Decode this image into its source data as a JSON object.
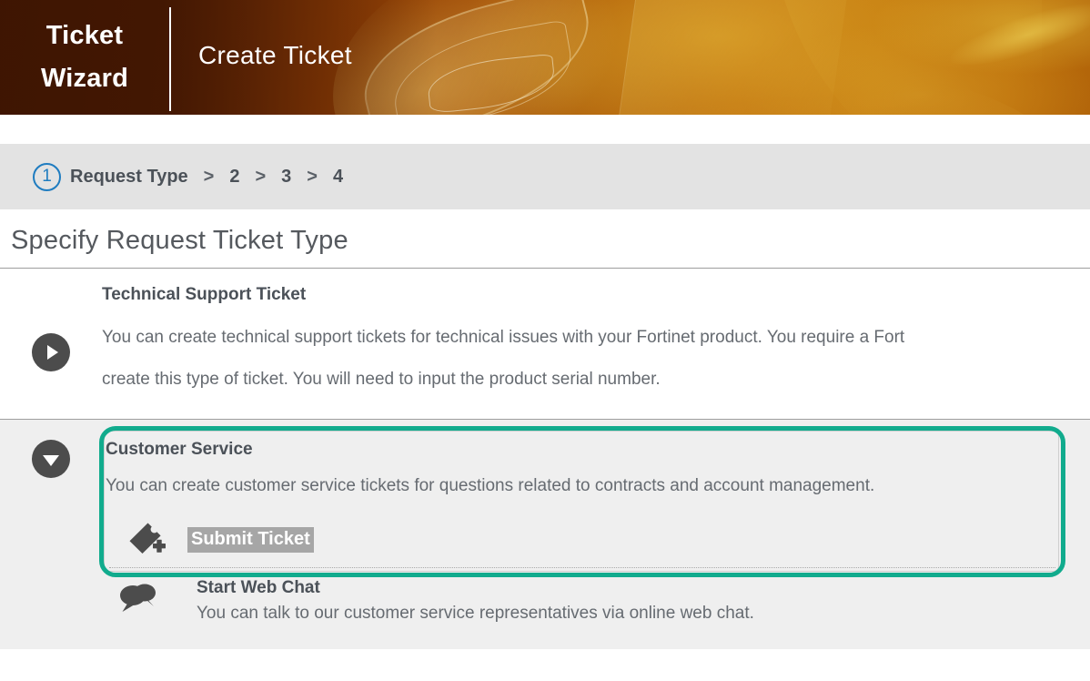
{
  "banner": {
    "brand_line1": "Ticket",
    "brand_line2": "Wizard",
    "title": "Create Ticket",
    "accent_dark": "#5d2305",
    "accent_light": "#c2740a"
  },
  "steps": {
    "current_number": "1",
    "current_label": "Request Type",
    "separator": ">",
    "remaining": [
      "2",
      "3",
      "4"
    ],
    "active_color": "#1f7cc0"
  },
  "page": {
    "title": "Specify Request Ticket Type"
  },
  "options": [
    {
      "id": "technical-support",
      "toggle_icon": "play-triangle-right-icon",
      "expanded": false,
      "heading": "Technical Support Ticket",
      "desc_line1": "You can create technical support tickets for technical issues with your Fortinet product. You require a Fort",
      "desc_line2": "create this type of ticket. You will need to input the product serial number."
    },
    {
      "id": "customer-service",
      "toggle_icon": "triangle-down-icon",
      "expanded": true,
      "highlighted": true,
      "highlight_color": "#11ab8d",
      "heading": "Customer Service",
      "desc_line1": "You can create customer service tickets for questions related to contracts and account management.",
      "actions": [
        {
          "id": "submit-ticket",
          "icon": "ticket-plus-icon",
          "label": "Submit Ticket",
          "selected": true,
          "selection_bg": "#a6a6a6"
        }
      ],
      "sub_items": [
        {
          "id": "start-web-chat",
          "icon": "chat-bubbles-icon",
          "heading": "Start Web Chat",
          "desc": "You can talk to our customer service representatives via online web chat."
        }
      ]
    }
  ]
}
